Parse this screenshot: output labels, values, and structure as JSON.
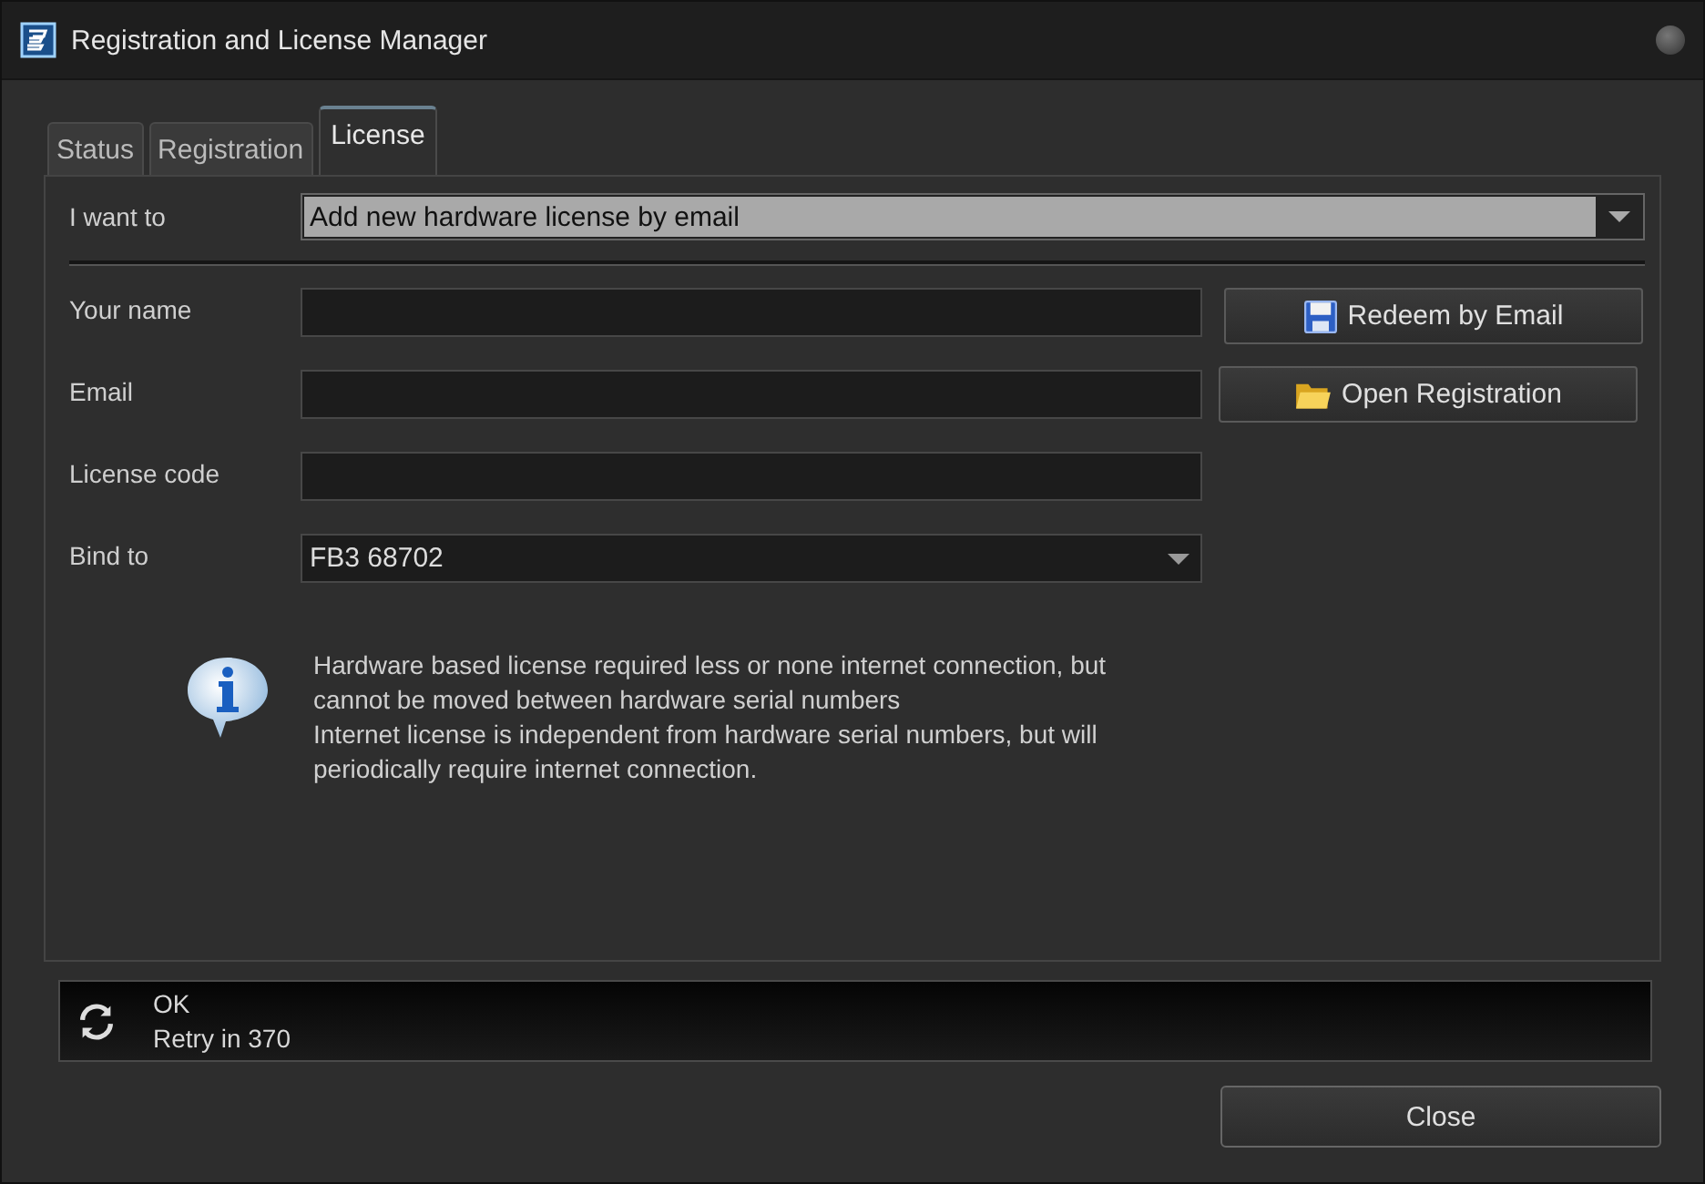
{
  "window": {
    "title": "Registration and License Manager"
  },
  "tabs": [
    {
      "label": "Status",
      "selected": false
    },
    {
      "label": "Registration",
      "selected": false
    },
    {
      "label": "License",
      "selected": true
    }
  ],
  "action": {
    "label": "I want to",
    "value": "Add new hardware license by email"
  },
  "fields": [
    {
      "kind": "text",
      "label": "Your name"
    },
    {
      "kind": "text",
      "label": "Email"
    },
    {
      "kind": "text",
      "label": "License code"
    },
    {
      "kind": "dropdown",
      "label": "Bind to",
      "value": "FB3 68702"
    }
  ],
  "buttons": [
    {
      "kind": "save",
      "label": "Redeem by Email"
    },
    {
      "kind": "folder",
      "label": "Open Registration"
    }
  ],
  "info": [
    "Hardware based license required less or none internet connection, but cannot be moved between hardware serial numbers",
    "Internet license is independent from hardware serial numbers, but will periodically require internet connection."
  ],
  "status": {
    "lines": [
      "OK",
      "Retry in 370"
    ]
  },
  "close_button": "Close"
}
